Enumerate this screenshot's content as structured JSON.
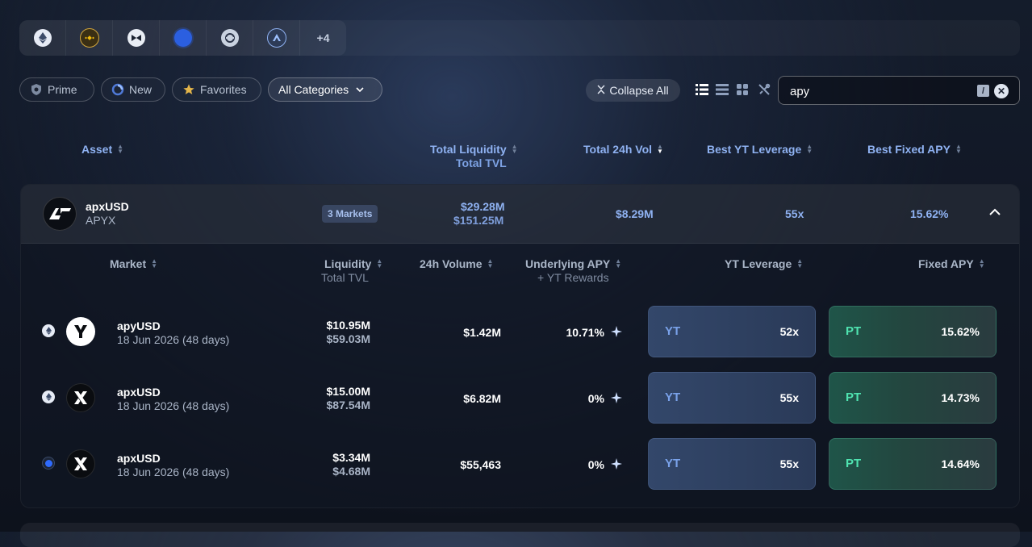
{
  "chains": {
    "items": [
      {
        "name": "ethereum-icon"
      },
      {
        "name": "bnb-icon"
      },
      {
        "name": "mantle-icon"
      },
      {
        "name": "base-icon"
      },
      {
        "name": "sonic-icon"
      },
      {
        "name": "arbitrum-icon"
      }
    ],
    "more_label": "+4"
  },
  "filters": {
    "prime_label": "Prime",
    "new_label": "New",
    "favorites_label": "Favorites",
    "categories_label": "All Categories",
    "collapse_label": "Collapse All"
  },
  "search": {
    "value": "apy",
    "shortcut": "/"
  },
  "table_header": {
    "asset": "Asset",
    "total_liquidity": "Total Liquidity",
    "total_tvl": "Total TVL",
    "total_24h_vol": "Total 24h Vol",
    "best_yt_leverage": "Best YT Leverage",
    "best_fixed_apy": "Best Fixed APY"
  },
  "asset": {
    "name": "apxUSD",
    "symbol": "APYX",
    "markets_badge": "3 Markets",
    "total_liquidity": "$29.28M",
    "total_tvl": "$151.25M",
    "total_24h_vol": "$8.29M",
    "best_yt_leverage": "55x",
    "best_fixed_apy": "15.62%"
  },
  "market_header": {
    "market": "Market",
    "liquidity": "Liquidity",
    "total_tvl": "Total TVL",
    "volume_24h": "24h Volume",
    "underlying_apy": "Underlying APY",
    "yt_rewards": "+ YT Rewards",
    "yt_leverage": "YT Leverage",
    "fixed_apy": "Fixed APY"
  },
  "markets": [
    {
      "chain": "ethereum",
      "logo": "apyusd-logo",
      "name": "apyUSD",
      "date": "18 Jun 2026 (48 days)",
      "liquidity": "$10.95M",
      "tvl": "$59.03M",
      "volume": "$1.42M",
      "underlying_apy": "10.71%",
      "yt_tag": "YT",
      "yt_leverage": "52x",
      "pt_tag": "PT",
      "fixed_apy": "15.62%"
    },
    {
      "chain": "ethereum",
      "logo": "apxusd-logo",
      "name": "apxUSD",
      "date": "18 Jun 2026 (48 days)",
      "liquidity": "$15.00M",
      "tvl": "$87.54M",
      "volume": "$6.82M",
      "underlying_apy": "0%",
      "yt_tag": "YT",
      "yt_leverage": "55x",
      "pt_tag": "PT",
      "fixed_apy": "14.73%"
    },
    {
      "chain": "base",
      "logo": "apxusd-logo",
      "name": "apxUSD",
      "date": "18 Jun 2026 (48 days)",
      "liquidity": "$3.34M",
      "tvl": "$4.68M",
      "volume": "$55,463",
      "underlying_apy": "0%",
      "yt_tag": "YT",
      "yt_leverage": "55x",
      "pt_tag": "PT",
      "fixed_apy": "14.64%"
    }
  ],
  "colors": {
    "accent_blue": "#8fb2f2",
    "pt_green": "#4fe3b0",
    "yt_blue": "#7aa2ea"
  }
}
